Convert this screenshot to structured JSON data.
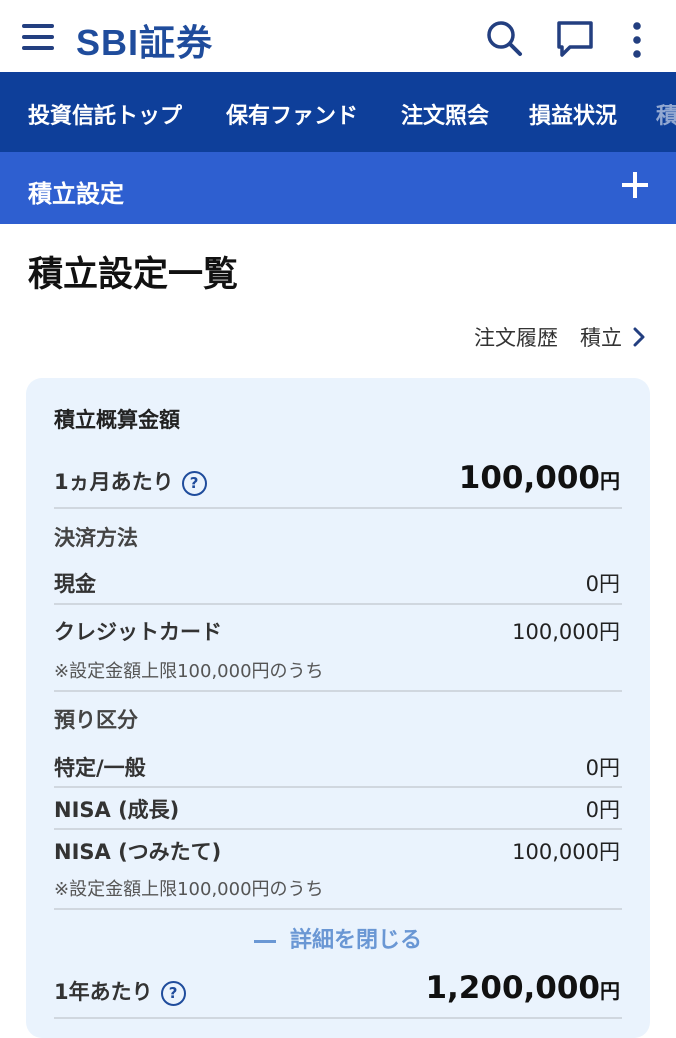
{
  "header": {
    "logo_text": "SBI",
    "logo_jp": "証券",
    "icons": [
      "hamburger-menu-icon",
      "search-icon",
      "chat-icon",
      "more-vertical-icon"
    ]
  },
  "nav": {
    "items": [
      "投資信託トップ",
      "保有ファンド",
      "注文照会",
      "損益状況",
      "積"
    ]
  },
  "subheader": {
    "title": "積立設定"
  },
  "page": {
    "title": "積立設定一覧",
    "links": [
      "注文履歴",
      "積立"
    ]
  },
  "card": {
    "title": "積立概算金額",
    "monthly": {
      "label": "1ヵ月あたり",
      "value": "100,000",
      "unit": "円"
    },
    "payment_section": "決済方法",
    "cash": {
      "label": "現金",
      "value": "0円"
    },
    "credit": {
      "label": "クレジットカード",
      "value": "100,000円",
      "note": "※設定金額上限100,000円のうち"
    },
    "account_section": "預り区分",
    "specific": {
      "label": "特定/一般",
      "value": "0円"
    },
    "nisa_growth": {
      "label": "NISA (成長)",
      "value": "0円"
    },
    "nisa_tsumitate": {
      "label": "NISA (つみたて)",
      "value": "100,000円",
      "note": "※設定金額上限100,000円のうち"
    },
    "collapse_label": "詳細を閉じる",
    "yearly": {
      "label": "1年あたり",
      "value": "1,200,000",
      "unit": "円"
    },
    "help_glyph": "?"
  },
  "colors": {
    "nav_bg": "#0e3f9a",
    "subheader_bg": "#2e5fd0",
    "card_bg": "#eaf3fd",
    "brand": "#1f4c9c",
    "collapse_link": "#6a97d4"
  }
}
